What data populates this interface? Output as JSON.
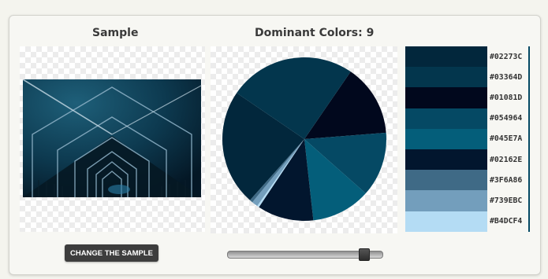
{
  "sample": {
    "title": "Sample",
    "button_label": "CHANGE THE SAMPLE"
  },
  "dominant": {
    "title": "Dominant Colors: 9"
  },
  "slider": {
    "value_fraction": 0.88
  },
  "colors": [
    {
      "hex": "#02273C",
      "label": "#02273C",
      "share": 0.13
    },
    {
      "hex": "#03364D",
      "label": "#03364D",
      "share": 0.14
    },
    {
      "hex": "#01081D",
      "label": "#01081D",
      "share": 0.13
    },
    {
      "hex": "#054964",
      "label": "#054964",
      "share": 0.11
    },
    {
      "hex": "#045E7A",
      "label": "#045E7A",
      "share": 0.1
    },
    {
      "hex": "#02162E",
      "label": "#02162E",
      "share": 0.1
    },
    {
      "hex": "#3F6A86",
      "label": "#3F6A86",
      "share": 0.01
    },
    {
      "hex": "#739EBC",
      "label": "#739EBC",
      "share": 0.01
    },
    {
      "hex": "#B4DCF4",
      "label": "#B4DCF4",
      "share": 0.01
    }
  ],
  "pie_order": [
    {
      "hex": "#01081D",
      "share": 0.142
    },
    {
      "hex": "#054964",
      "share": 0.128
    },
    {
      "hex": "#045E7A",
      "share": 0.117
    },
    {
      "hex": "#02162E",
      "share": 0.111
    },
    {
      "hex": "#B4DCF4",
      "share": 0.004
    },
    {
      "hex": "#739EBC",
      "share": 0.012
    },
    {
      "hex": "#3F6A86",
      "share": 0.006
    },
    {
      "hex": "#02273C",
      "share": 0.23
    },
    {
      "hex": "#03364D",
      "share": 0.25
    }
  ]
}
